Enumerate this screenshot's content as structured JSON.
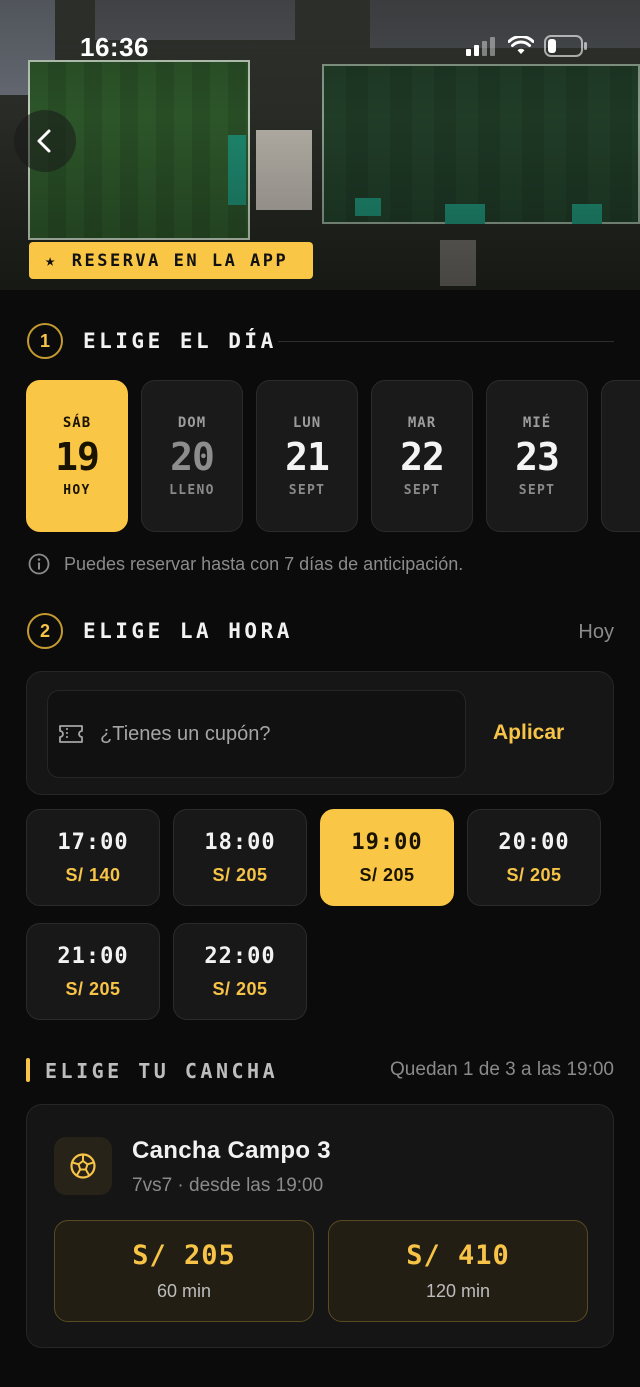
{
  "status_bar": {
    "time": "16:36"
  },
  "hero": {
    "badge_icon": "star-icon",
    "badge_label": "RESERVA EN LA APP"
  },
  "step_day": {
    "number": "1",
    "title": "ELIGE EL DÍA",
    "days": [
      {
        "weekday": "SÁB",
        "day": "19",
        "sub": "HOY",
        "selected": true
      },
      {
        "weekday": "DOM",
        "day": "20",
        "sub": "LLENO",
        "selected": false
      },
      {
        "weekday": "LUN",
        "day": "21",
        "sub": "SEPT",
        "selected": false
      },
      {
        "weekday": "MAR",
        "day": "22",
        "sub": "SEPT",
        "selected": false
      },
      {
        "weekday": "MIÉ",
        "day": "23",
        "sub": "SEPT",
        "selected": false
      }
    ],
    "info": "Puedes reservar hasta con 7 días de anticipación."
  },
  "step_time": {
    "number": "2",
    "title": "ELIGE LA HORA",
    "date_label": "Hoy",
    "coupon_placeholder": "¿Tienes un cupón?",
    "apply_label": "Aplicar",
    "slots": [
      {
        "time": "17:00",
        "price": "S/ 140",
        "selected": false
      },
      {
        "time": "18:00",
        "price": "S/ 205",
        "selected": false
      },
      {
        "time": "19:00",
        "price": "S/ 205",
        "selected": true
      },
      {
        "time": "20:00",
        "price": "S/ 205",
        "selected": false
      },
      {
        "time": "21:00",
        "price": "S/ 205",
        "selected": false
      },
      {
        "time": "22:00",
        "price": "S/ 205",
        "selected": false
      }
    ]
  },
  "step_court": {
    "title": "ELIGE TU CANCHA",
    "availability": "Quedan 1 de 3 a las 19:00",
    "court": {
      "icon": "soccer-ball-icon",
      "name": "Cancha Campo 3",
      "subtitle": "7vs7 · desde las 19:00",
      "options": [
        {
          "price": "S/ 205",
          "duration": "60 min"
        },
        {
          "price": "S/ 410",
          "duration": "120 min"
        }
      ]
    }
  },
  "colors": {
    "accent": "#f9c645",
    "background": "#0b0b0b",
    "card": "#1a1a1a"
  }
}
